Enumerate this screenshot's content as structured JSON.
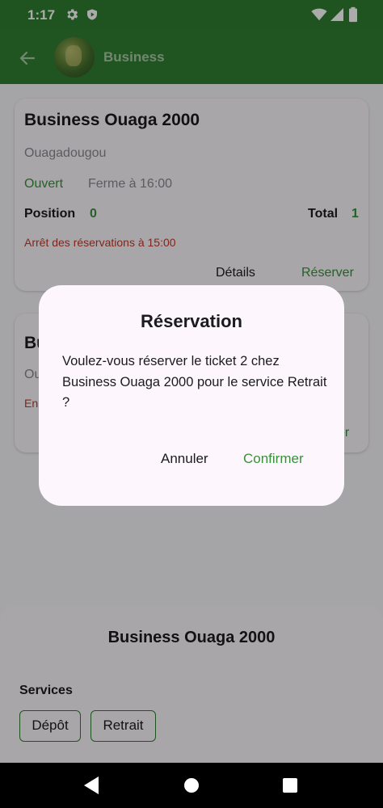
{
  "status_bar": {
    "time": "1:17"
  },
  "app_bar": {
    "title": "Business"
  },
  "cards": [
    {
      "title": "Business Ouaga 2000",
      "city": "Ouagadougou",
      "open_status": "Ouvert",
      "close_time": "Ferme à 16:00",
      "position_label": "Position",
      "position_value": "0",
      "total_label": "Total",
      "total_value": "1",
      "stop_notice": "Arrêt des réservations à 15:00",
      "details_label": "Détails",
      "reserve_label": "Réserver"
    },
    {
      "title_partial": "Bu",
      "city_partial": "Ou",
      "status_partial": "En",
      "reserve_partial": "ver"
    }
  ],
  "sheet": {
    "title": "Business Ouaga 2000",
    "services_label": "Services",
    "services": [
      "Dépôt",
      "Retrait"
    ]
  },
  "dialog": {
    "title": "Réservation",
    "body": "Voulez-vous réserver le ticket 2 chez Business Ouaga 2000 pour le service Retrait ?",
    "cancel_label": "Annuler",
    "confirm_label": "Confirmer"
  },
  "colors": {
    "primary": "#2f7e30",
    "accent_text": "#3a8f3d",
    "warning_text": "#c0392b"
  }
}
